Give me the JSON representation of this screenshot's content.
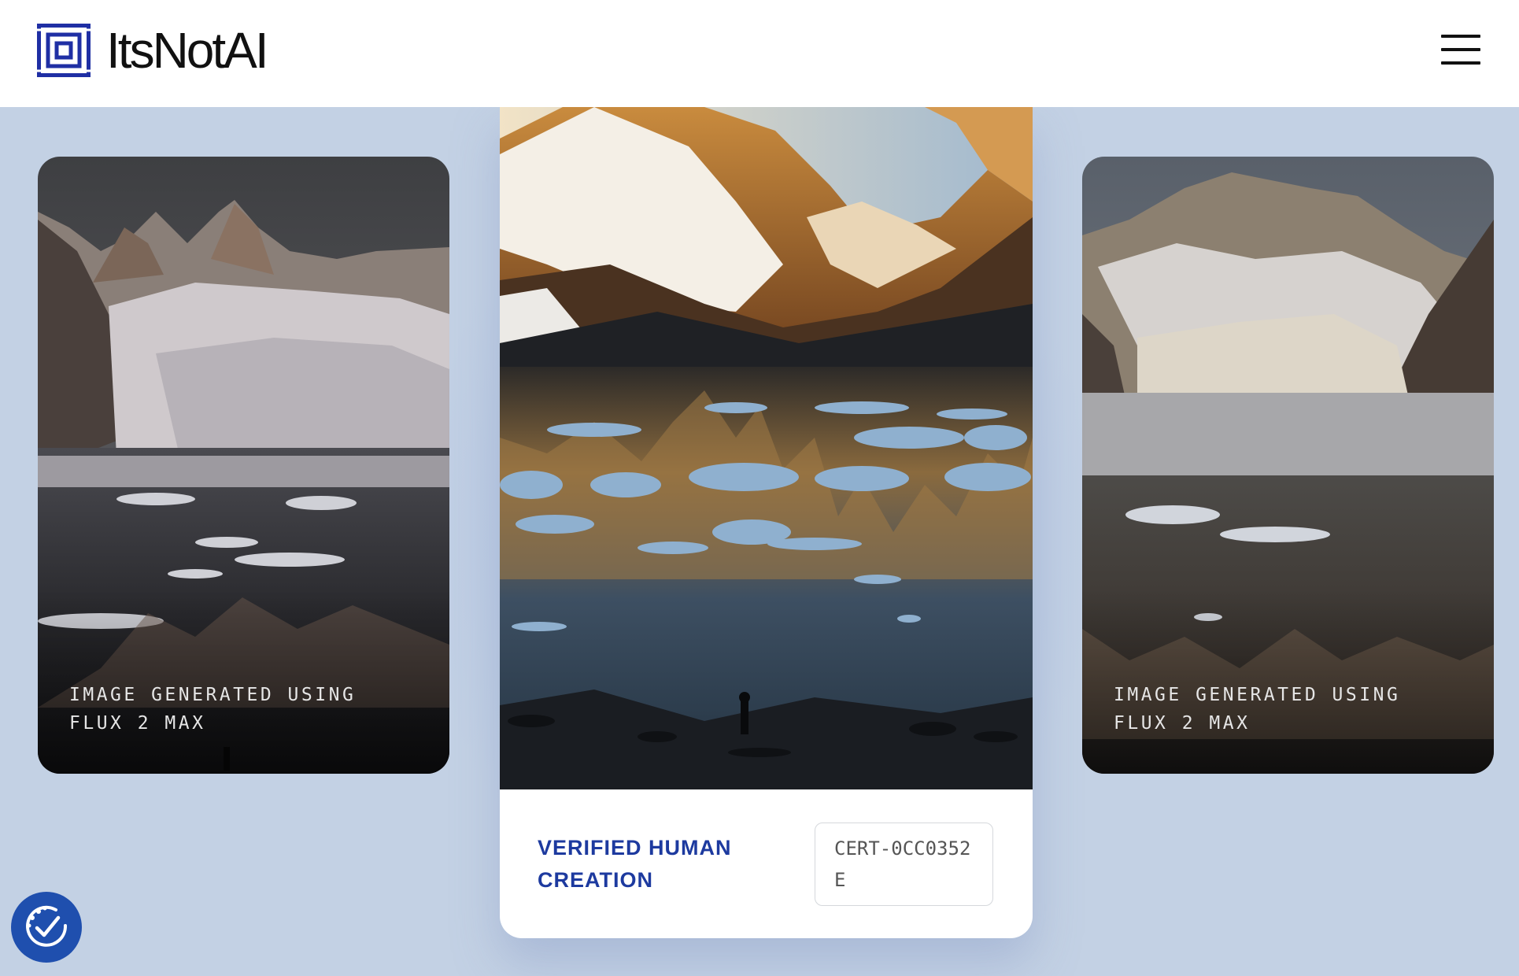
{
  "header": {
    "brand": "ItsNotAI",
    "logo_icon": "concentric-squares-logo",
    "menu_icon": "hamburger-menu-icon"
  },
  "cards": {
    "left": {
      "caption": "IMAGE GENERATED USING FLUX 2 MAX"
    },
    "center": {
      "badge": "VERIFIED HUMAN CREATION",
      "certificate": "CERT-0CC0352E"
    },
    "right": {
      "caption": "IMAGE GENERATED USING FLUX 2 MAX"
    }
  },
  "accessibility": {
    "icon": "accessibility-check-icon"
  },
  "colors": {
    "brand_blue": "#1d3a9f",
    "background": "#c3d1e4",
    "a11y_button": "#1f4fae"
  }
}
